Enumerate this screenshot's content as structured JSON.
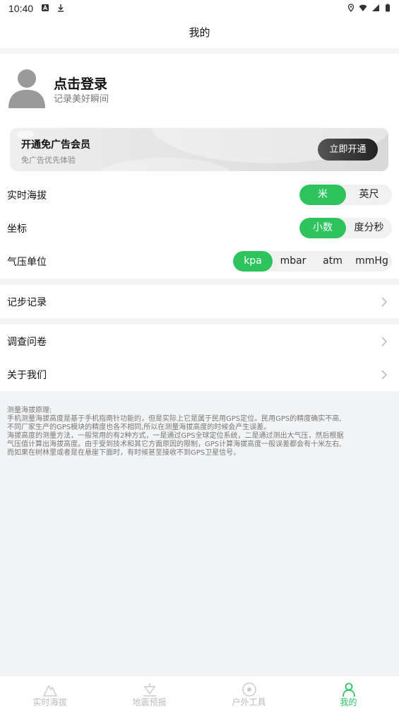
{
  "status_bar": {
    "time": "10:40"
  },
  "header": {
    "title": "我的"
  },
  "profile": {
    "title": "点击登录",
    "subtitle": "记录美好瞬间"
  },
  "vip": {
    "title": "开通免广告会员",
    "subtitle": "免广告优先体验",
    "button_label": "立即开通"
  },
  "settings": {
    "altitude": {
      "label": "实时海拔",
      "options": [
        "米",
        "英尺"
      ],
      "selected": "米"
    },
    "coordinate": {
      "label": "坐标",
      "options": [
        "小数",
        "度分秒"
      ],
      "selected": "小数"
    },
    "pressure": {
      "label": "气压单位",
      "options": [
        "kpa",
        "mbar",
        "atm",
        "mmHg"
      ],
      "selected": "kpa"
    }
  },
  "menu": {
    "step_record": "记步记录",
    "survey": "调查问卷",
    "about": "关于我们"
  },
  "note": {
    "lines": [
      "测量海拔原理:",
      "手机测量海拔高度是基于手机指南针功能的，但是实际上它是属于民用GPS定位。民用GPS的精度确实不高,",
      "不同厂家生产的GPS模块的精度也各不相同,所以在测量海拔高度的时候会产生误差。",
      "海拔高度的测量方法，一般常用的有2种方式，一是通过GPS全球定位系统，二是通过测出大气压，然后根据",
      "气压值计算出海拔高度。由于受到技术和其它方面原因的限制，GPS计算海拔高度一般误差都会有十米左右,",
      "而如果在树林里或者是在悬崖下面时，有时候甚至接收不到GPS卫星信号。"
    ]
  },
  "tabbar": {
    "tabs": [
      {
        "label": "实时海拔",
        "icon": "mountain-icon"
      },
      {
        "label": "地震预报",
        "icon": "earthquake-icon"
      },
      {
        "label": "户外工具",
        "icon": "compass-icon"
      },
      {
        "label": "我的",
        "icon": "user-icon"
      }
    ],
    "active": "我的"
  },
  "colors": {
    "accent": "#2dc35d",
    "background": "#f3f4f6"
  }
}
